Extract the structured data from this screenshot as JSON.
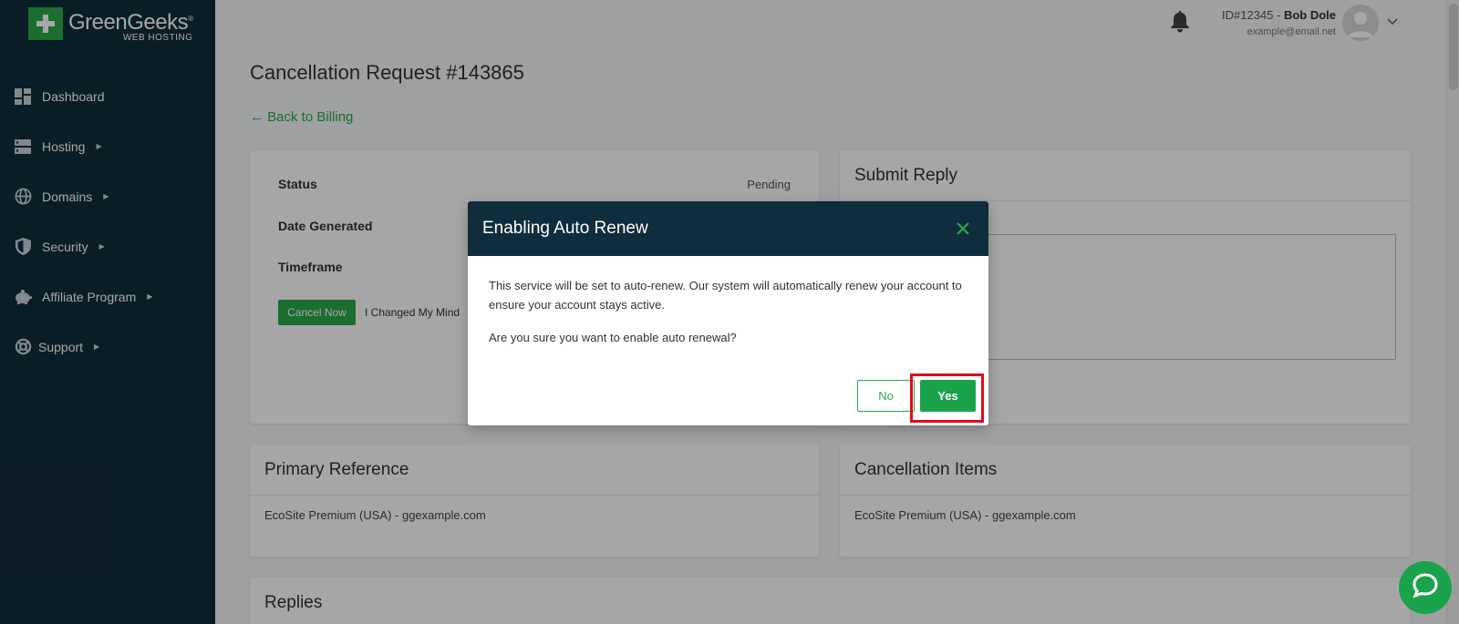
{
  "brand": {
    "name": "GreenGeeks",
    "sub": "WEB HOSTING",
    "reg": "®"
  },
  "sidebar": {
    "items": [
      {
        "label": "Dashboard",
        "icon": "dashboard-icon",
        "has_caret": false
      },
      {
        "label": "Hosting",
        "icon": "server-icon",
        "has_caret": true
      },
      {
        "label": "Domains",
        "icon": "globe-icon",
        "has_caret": true
      },
      {
        "label": "Security",
        "icon": "shield-icon",
        "has_caret": true
      },
      {
        "label": "Affiliate Program",
        "icon": "piggy-bank-icon",
        "has_caret": true
      },
      {
        "label": "Support",
        "icon": "lifebuoy-icon",
        "has_caret": true
      }
    ]
  },
  "header": {
    "user_id": "ID#12345 - ",
    "user_name": "Bob Dole",
    "user_email": "example@email.net"
  },
  "page": {
    "title": "Cancellation Request #143865",
    "back_link": "← Back to Billing",
    "status_card": {
      "rows": [
        {
          "label": "Status",
          "value": "Pending"
        },
        {
          "label": "Date Generated",
          "value": ""
        },
        {
          "label": "Timeframe",
          "value": ""
        }
      ],
      "cancel_button": "Cancel Now",
      "changed_mind_button": "I Changed My Mind"
    },
    "submit_reply": {
      "title": "Submit Reply"
    },
    "primary_reference": {
      "title": "Primary Reference",
      "item": "EcoSite Premium (USA) - ggexample.com"
    },
    "cancellation_items": {
      "title": "Cancellation Items",
      "item": "EcoSite Premium (USA) - ggexample.com"
    },
    "replies": {
      "title": "Replies"
    }
  },
  "modal": {
    "title": "Enabling Auto Renew",
    "body_1": "This service will be set to auto-renew. Our system will automatically renew your account to ensure your account stays active.",
    "body_2": "Are you sure you want to enable auto renewal?",
    "no_label": "No",
    "yes_label": "Yes"
  },
  "colors": {
    "accent": "#2aa84a",
    "sidebar": "#0f2d3c",
    "highlight": "#e10c1c"
  }
}
